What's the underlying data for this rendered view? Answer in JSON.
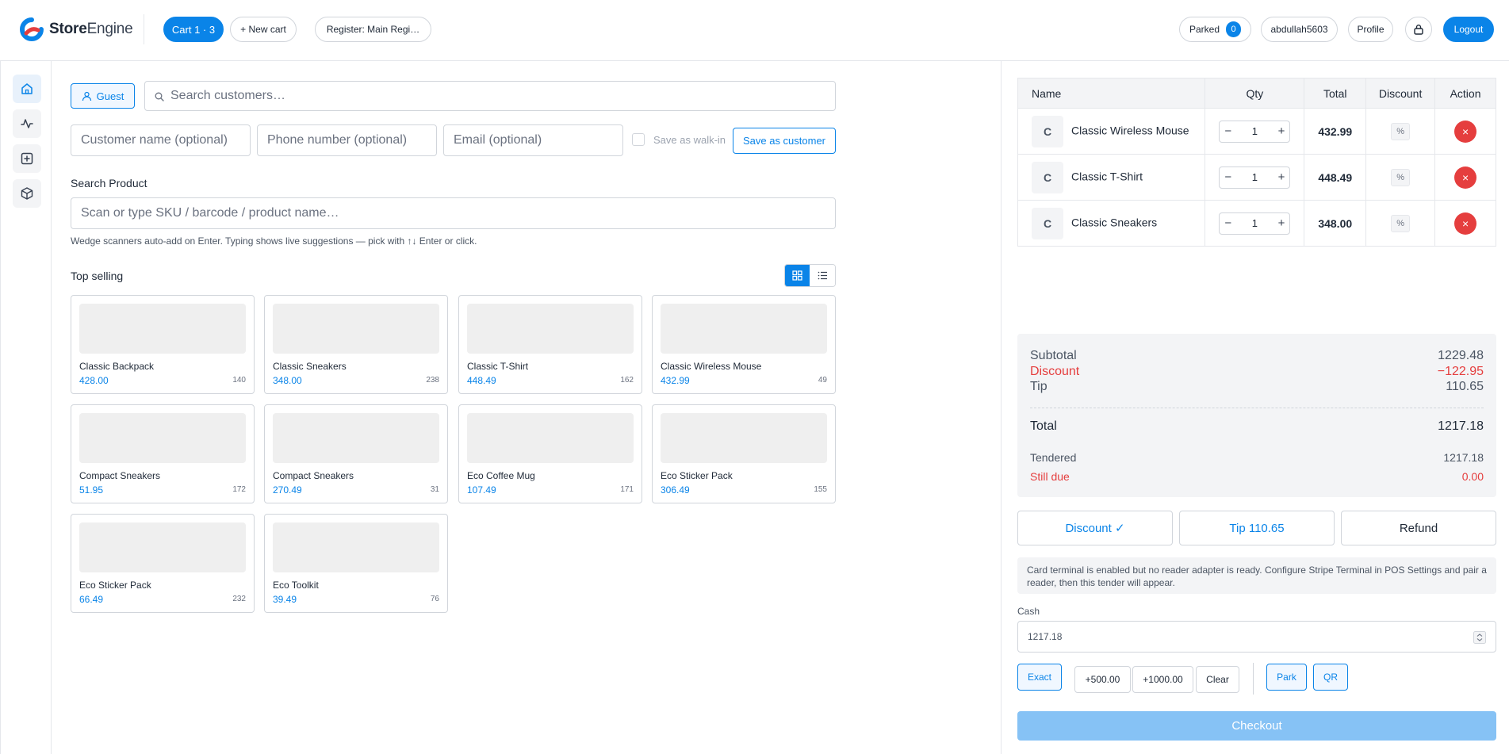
{
  "header": {
    "brand_bold": "Store",
    "brand_light": "Engine",
    "cart_tab": "Cart 1 · 3",
    "new_cart": "+ New cart",
    "register": "Register: Main Regi…",
    "parked": "Parked",
    "parked_count": "0",
    "user": "abdullah5603",
    "profile": "Profile",
    "logout": "Logout"
  },
  "sidebar": {
    "items": [
      {
        "icon": "home-icon",
        "active": true
      },
      {
        "icon": "activity-icon",
        "active": false
      },
      {
        "icon": "add-square-icon",
        "active": false
      },
      {
        "icon": "box-icon",
        "active": false
      }
    ]
  },
  "customer": {
    "guest_label": "Guest",
    "search_placeholder": "Search customers…",
    "name_placeholder": "Customer name (optional)",
    "phone_placeholder": "Phone number (optional)",
    "email_placeholder": "Email (optional)",
    "walkin_label": "Save as walk-in",
    "save_button": "Save as customer"
  },
  "search": {
    "label": "Search Product",
    "placeholder": "Scan or type SKU / barcode / product name…",
    "hint": "Wedge scanners auto-add on Enter. Typing shows live suggestions — pick with ↑↓ Enter or click."
  },
  "top_selling": {
    "title": "Top selling",
    "products": [
      {
        "name": "Classic Backpack",
        "price": "428.00",
        "stock": "140"
      },
      {
        "name": "Classic Sneakers",
        "price": "348.00",
        "stock": "238"
      },
      {
        "name": "Classic T-Shirt",
        "price": "448.49",
        "stock": "162"
      },
      {
        "name": "Classic Wireless Mouse",
        "price": "432.99",
        "stock": "49"
      },
      {
        "name": "Compact Sneakers",
        "price": "51.95",
        "stock": "172"
      },
      {
        "name": "Compact Sneakers",
        "price": "270.49",
        "stock": "31"
      },
      {
        "name": "Eco Coffee Mug",
        "price": "107.49",
        "stock": "171"
      },
      {
        "name": "Eco Sticker Pack",
        "price": "306.49",
        "stock": "155"
      },
      {
        "name": "Eco Sticker Pack",
        "price": "66.49",
        "stock": "232"
      },
      {
        "name": "Eco Toolkit",
        "price": "39.49",
        "stock": "76"
      }
    ]
  },
  "cart": {
    "columns": [
      "Name",
      "Qty",
      "Total",
      "Discount",
      "Action"
    ],
    "items": [
      {
        "initial": "C",
        "name": "Classic Wireless Mouse",
        "qty": "1",
        "total": "432.99",
        "discount": "%",
        "remove": "×"
      },
      {
        "initial": "C",
        "name": "Classic T-Shirt",
        "qty": "1",
        "total": "448.49",
        "discount": "%",
        "remove": "×"
      },
      {
        "initial": "C",
        "name": "Classic Sneakers",
        "qty": "1",
        "total": "348.00",
        "discount": "%",
        "remove": "×"
      }
    ]
  },
  "summary": {
    "subtotal_label": "Subtotal",
    "subtotal": "1229.48",
    "discount_label": "Discount",
    "discount": "−122.95",
    "tip_label": "Tip",
    "tip": "110.65",
    "total_label": "Total",
    "total": "1217.18",
    "tendered_label": "Tendered",
    "tendered": "1217.18",
    "due_label": "Still due",
    "due": "0.00"
  },
  "actions": {
    "discount": "Discount ✓",
    "tip": "Tip 110.65",
    "refund": "Refund"
  },
  "terminal_notice": "Card terminal is enabled but no reader adapter is ready. Configure Stripe Terminal in POS Settings and pair a reader, then this tender will appear.",
  "payment": {
    "cash_label": "Cash",
    "cash_value": "1217.18",
    "exact": "Exact",
    "plus500": "+500.00",
    "plus1000": "+1000.00",
    "clear": "Clear",
    "park": "Park",
    "qr": "QR",
    "checkout": "Checkout"
  },
  "colors": {
    "accent": "#0a84e8",
    "danger": "#e53e3e",
    "checkout_disabled": "#86c2f5"
  }
}
